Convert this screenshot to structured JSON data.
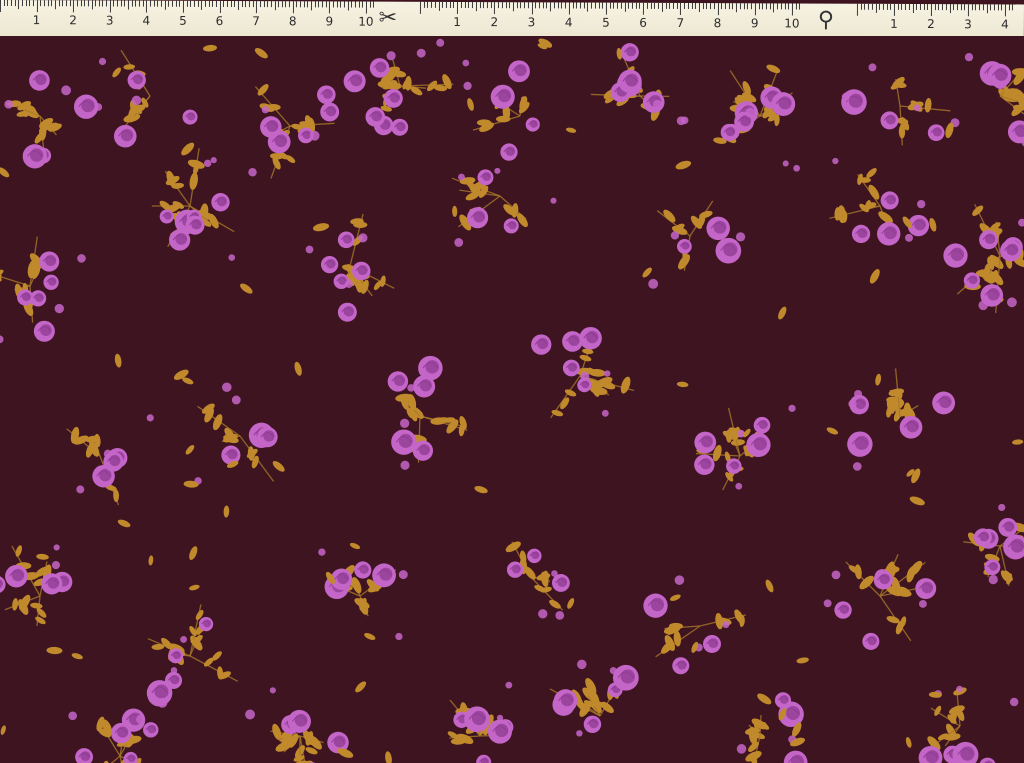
{
  "tape": {
    "segments": [
      {
        "numbers": [
          "1",
          "2",
          "3",
          "4",
          "5",
          "6",
          "7",
          "8",
          "9",
          "10"
        ],
        "icon": "scissors-icon",
        "icon_glyph": "✂"
      },
      {
        "numbers": [
          "1",
          "2",
          "3",
          "4",
          "5",
          "6",
          "7",
          "8",
          "9",
          "10"
        ],
        "icon": "thread-spool-icon",
        "icon_glyph": "⚲"
      },
      {
        "numbers": [
          "1",
          "2",
          "3",
          "4"
        ]
      }
    ]
  },
  "fabric": {
    "background_color": "#3e1420",
    "rose_color": "#c465c8",
    "rose_dark_color": "#8e3b92",
    "leaf_color": "#c08a2c",
    "stem_color": "#a8782a"
  }
}
